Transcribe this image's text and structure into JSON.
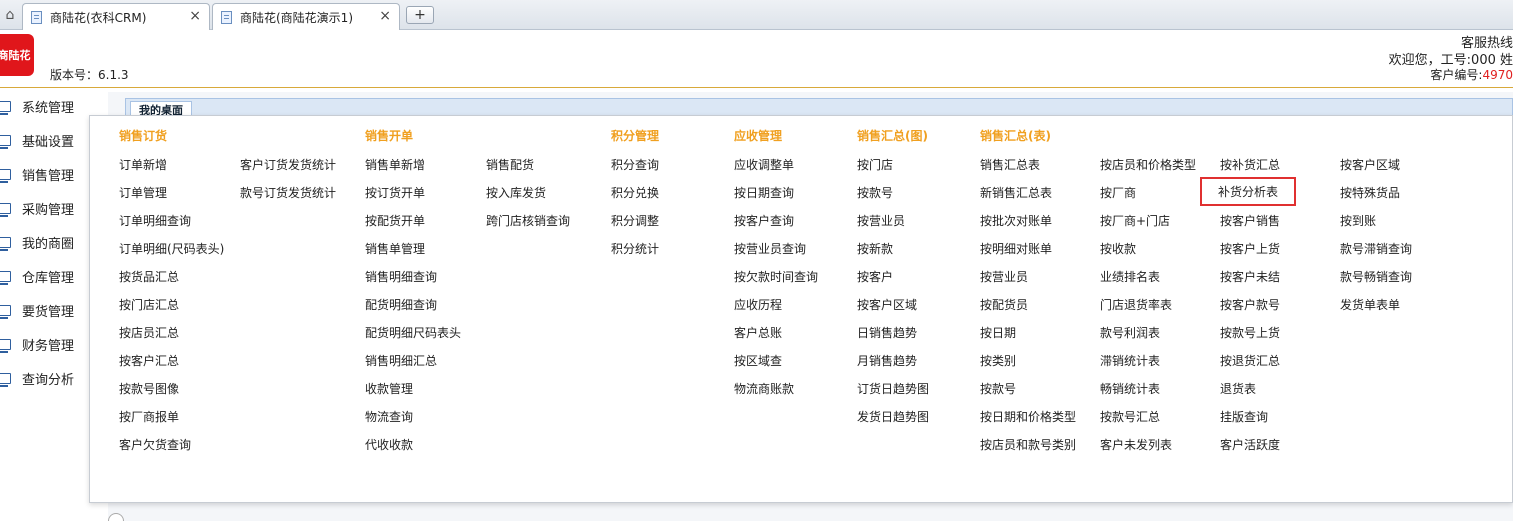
{
  "tabs": [
    {
      "label": "商陆花(衣科CRM)",
      "close": "×"
    },
    {
      "label": "商陆花(商陆花演示1)",
      "close": "×"
    }
  ],
  "new_tab_label": "+",
  "home_icon_glyph": "⌂",
  "header": {
    "logo_text": "商陆花",
    "version": "版本号：6.1.3",
    "hotline": "客服热线",
    "welcome": "欢迎您，工号:000 姓",
    "customer_no_label": "客户编号:",
    "customer_no_value": "4970"
  },
  "sidebar": [
    {
      "label": "系统管理"
    },
    {
      "label": "基础设置"
    },
    {
      "label": "销售管理"
    },
    {
      "label": "采购管理"
    },
    {
      "label": "我的商圈"
    },
    {
      "label": "仓库管理"
    },
    {
      "label": "要货管理"
    },
    {
      "label": "财务管理"
    },
    {
      "label": "查询分析"
    }
  ],
  "desk_tab": "我的桌面",
  "menu": {
    "headings": [
      "销售订货",
      "销售开单",
      "积分管理",
      "应收管理",
      "销售汇总(图)",
      "销售汇总(表)"
    ],
    "col1": [
      "订单新增",
      "订单管理",
      "订单明细查询",
      "订单明细(尺码表头)",
      "按货品汇总",
      "按门店汇总",
      "按店员汇总",
      "按客户汇总",
      "按款号图像",
      "按厂商报单",
      "客户欠货查询"
    ],
    "col2": [
      "客户订货发货统计",
      "款号订货发货统计"
    ],
    "col3": [
      "销售单新增",
      "按订货开单",
      "按配货开单",
      "销售单管理",
      "销售明细查询",
      "配货明细查询",
      "配货明细尺码表头",
      "销售明细汇总",
      "收款管理",
      "物流查询",
      "代收收款"
    ],
    "col4": [
      "销售配货",
      "按入库发货",
      "跨门店核销查询"
    ],
    "col5": [
      "积分查询",
      "积分兑换",
      "积分调整",
      "积分统计"
    ],
    "col6": [
      "应收调整单",
      "按日期查询",
      "按客户查询",
      "按营业员查询",
      "按欠款时间查询",
      "应收历程",
      "客户总账",
      "按区域查",
      "物流商账款"
    ],
    "col7": [
      "按门店",
      "按款号",
      "按营业员",
      "按新款",
      "按客户",
      "按客户区域",
      "日销售趋势",
      "月销售趋势",
      "订货日趋势图",
      "发货日趋势图"
    ],
    "col8": [
      "销售汇总表",
      "新销售汇总表",
      "按批次对账单",
      "按明细对账单",
      "按营业员",
      "按配货员",
      "按日期",
      "按类别",
      "按款号",
      "按日期和价格类型",
      "按店员和款号类别"
    ],
    "col9": [
      "按店员和价格类型",
      "按厂商",
      "按厂商+门店",
      "按收款",
      "业绩排名表",
      "门店退货率表",
      "款号利润表",
      "滞销统计表",
      "畅销统计表",
      "按款号汇总",
      "客户未发列表"
    ],
    "col10": [
      "按补货汇总",
      "补货分析表",
      "按客户销售",
      "按客户上货",
      "按客户未结",
      "按客户款号",
      "按款号上货",
      "按退货汇总",
      "退货表",
      "挂版查询",
      "客户活跃度"
    ],
    "col11": [
      "按客户区域",
      "按特殊货品",
      "按到账",
      "款号滞销查询",
      "款号畅销查询",
      "发货单表单"
    ]
  }
}
